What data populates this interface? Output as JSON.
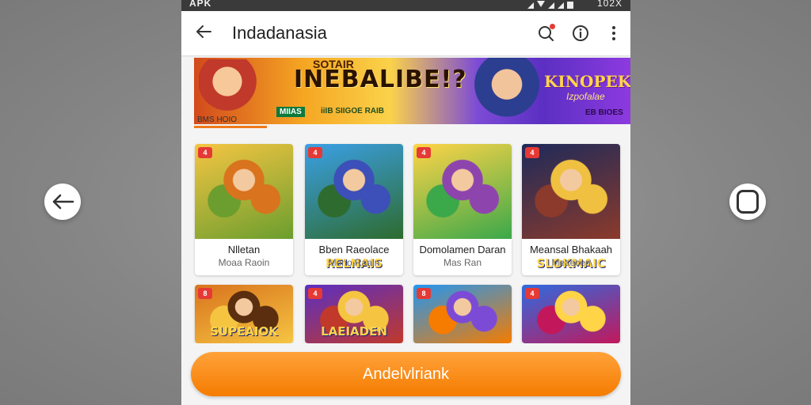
{
  "status_bar": {
    "left": "APK",
    "right": "102X"
  },
  "app_bar": {
    "title": "Indadanasia"
  },
  "banner": {
    "headline_top": "SOTAIR",
    "headline": "INEBALIBE!?",
    "sub_left": "MIIAS",
    "sub_right": "iiIB SIIGOE RAIB",
    "logo": "KINOPEK",
    "logo_sub": "Izpofalae",
    "corner": "EB BIOES",
    "caption": "BMS HOIO"
  },
  "games": [
    {
      "badge": "4",
      "art_label": "",
      "name": "Nlletan",
      "sub": "Moaa Raoin",
      "colors": [
        "#f5c542",
        "#6b9e2e",
        "#d9731d"
      ]
    },
    {
      "badge": "4",
      "art_label": "RELNAIS",
      "name": "Bben Raeolace",
      "sub": "Meno Raain",
      "colors": [
        "#3aa0e6",
        "#2e6b2e",
        "#3d4fb8"
      ]
    },
    {
      "badge": "4",
      "art_label": "",
      "name": "Domolamen Daran",
      "sub": "Mas Ran",
      "colors": [
        "#ffd447",
        "#3ba84a",
        "#8e44ad"
      ]
    },
    {
      "badge": "4",
      "art_label": "SLOKMAIC",
      "name": "Meansal Bhakaah",
      "sub": "Meaecen",
      "colors": [
        "#1e2a5a",
        "#8b3a2b",
        "#f0c040"
      ]
    },
    {
      "badge": "8",
      "art_label": "SUPEAIOK",
      "colors": [
        "#d9731d",
        "#f5c542",
        "#5a2e0e"
      ]
    },
    {
      "badge": "4",
      "art_label": "LAEIADEN",
      "colors": [
        "#5b2fc2",
        "#c0392b",
        "#f5c542"
      ]
    },
    {
      "badge": "8",
      "art_label": "",
      "colors": [
        "#2196f3",
        "#f57c00",
        "#7c4bd6"
      ]
    },
    {
      "badge": "4",
      "art_label": "",
      "colors": [
        "#2e6be0",
        "#c2185b",
        "#ffd447"
      ]
    }
  ],
  "cta": {
    "label": "Andelvlriank"
  },
  "icons": {
    "back": "arrow-left-icon",
    "search": "search-icon",
    "info": "info-icon",
    "more": "more-vertical-icon",
    "outer_back": "arrow-left-icon",
    "outer_home": "rounded-square-icon"
  },
  "accent_color": "#f57c00"
}
